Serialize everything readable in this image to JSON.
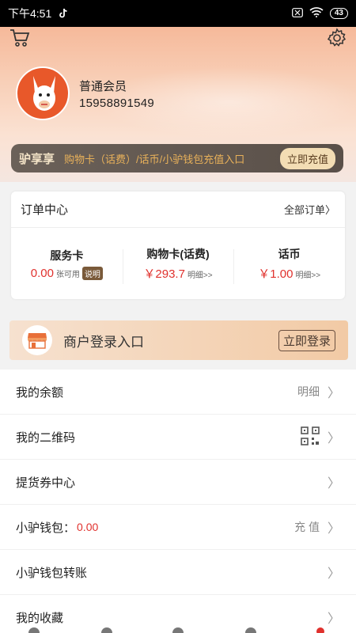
{
  "status_bar": {
    "time": "下午4:51",
    "battery": "43"
  },
  "hero": {
    "member_level": "普通会员",
    "phone": "15958891549",
    "enjoy": {
      "title": "驴享享",
      "desc": "购物卡（话费）/话币/小驴钱包充值入口",
      "button": "立即充值"
    }
  },
  "orders": {
    "title": "订单中心",
    "all_label": "全部订单〉",
    "stats": [
      {
        "label": "服务卡",
        "value": "0.00",
        "unit": "张可用",
        "badge": "说明"
      },
      {
        "label": "购物卡(话费)",
        "value": "￥293.7",
        "unit": "明细>>"
      },
      {
        "label": "话币",
        "value": "￥1.00",
        "unit": "明细>>"
      }
    ]
  },
  "merchant": {
    "label": "商户登录入口",
    "button": "立即登录"
  },
  "menu": [
    {
      "label": "我的余额",
      "right": "明细"
    },
    {
      "label": "我的二维码"
    },
    {
      "label": "提货券中心"
    },
    {
      "label": "小驴钱包：",
      "amount": "0.00",
      "right": "充 值"
    },
    {
      "label": "小驴钱包转账"
    },
    {
      "label": "我的收藏"
    }
  ],
  "colors": {
    "accent_red": "#e0312d",
    "gold_button": "#f3ddb4"
  }
}
